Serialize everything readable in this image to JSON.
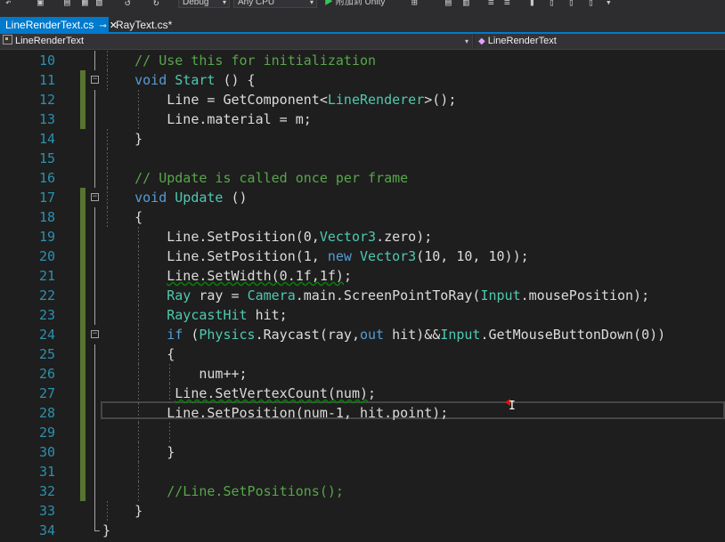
{
  "toolbar": {
    "config_value": "Debug",
    "platform_value": "Any CPU",
    "run_label": "附加到 Unity",
    "play_icon": "play-icon"
  },
  "tabs": [
    {
      "label": "LineRenderText.cs",
      "active": true
    },
    {
      "label": "RayText.cs*",
      "active": false
    }
  ],
  "navbar": {
    "class_selector": "LineRenderText",
    "member_selector": "LineRenderText"
  },
  "colors": {
    "accent": "#007acc",
    "keyword": "#569cd6",
    "type": "#4ec9b0",
    "comment": "#57a64a",
    "line_number": "#2b91af",
    "change_bar": "#577430"
  },
  "editor": {
    "current_line": 28,
    "lines": [
      {
        "n": "10",
        "segments": [
          [
            "cm",
            "    // Use this for initialization"
          ]
        ]
      },
      {
        "n": "11",
        "segments": [
          [
            "kw",
            "    void"
          ],
          [
            "pl",
            " "
          ],
          [
            "ty",
            "Start"
          ],
          [
            "pl",
            " () {"
          ]
        ]
      },
      {
        "n": "12",
        "segments": [
          [
            "pl",
            "        Line = GetComponent"
          ],
          [
            "pl",
            "<"
          ],
          [
            "ty",
            "LineRenderer"
          ],
          [
            "pl",
            ">();"
          ]
        ]
      },
      {
        "n": "13",
        "segments": [
          [
            "pl",
            "        Line.material = m;"
          ]
        ]
      },
      {
        "n": "14",
        "segments": [
          [
            "pl",
            "    }"
          ]
        ]
      },
      {
        "n": "15",
        "segments": [
          [
            "pl",
            ""
          ]
        ]
      },
      {
        "n": "16",
        "segments": [
          [
            "cm",
            "    // Update is called once per frame"
          ]
        ]
      },
      {
        "n": "17",
        "segments": [
          [
            "kw",
            "    void"
          ],
          [
            "pl",
            " "
          ],
          [
            "ty",
            "Update"
          ],
          [
            "pl",
            " ()"
          ]
        ]
      },
      {
        "n": "18",
        "segments": [
          [
            "pl",
            "    {"
          ]
        ]
      },
      {
        "n": "19",
        "segments": [
          [
            "pl",
            "        Line.SetPosition(0,"
          ],
          [
            "ty",
            "Vector3"
          ],
          [
            "pl",
            ".zero);"
          ]
        ]
      },
      {
        "n": "20",
        "segments": [
          [
            "pl",
            "        Line.SetPosition(1, "
          ],
          [
            "kw",
            "new"
          ],
          [
            "pl",
            " "
          ],
          [
            "ty",
            "Vector3"
          ],
          [
            "pl",
            "(10, 10, 10));"
          ]
        ]
      },
      {
        "n": "21",
        "segments": [
          [
            "pl",
            "        "
          ],
          [
            "sq",
            "Line.SetWidth(0.1f,1f)"
          ],
          [
            "pl",
            ";"
          ]
        ]
      },
      {
        "n": "22",
        "segments": [
          [
            "ty",
            "        Ray"
          ],
          [
            "pl",
            " ray = "
          ],
          [
            "ty",
            "Camera"
          ],
          [
            "pl",
            ".main.ScreenPointToRay("
          ],
          [
            "ty",
            "Input"
          ],
          [
            "pl",
            ".mousePosition);"
          ]
        ]
      },
      {
        "n": "23",
        "segments": [
          [
            "ty",
            "        RaycastHit"
          ],
          [
            "pl",
            " hit;"
          ]
        ]
      },
      {
        "n": "24",
        "segments": [
          [
            "kw",
            "        if"
          ],
          [
            "pl",
            " ("
          ],
          [
            "ty",
            "Physics"
          ],
          [
            "pl",
            ".Raycast(ray,"
          ],
          [
            "kw",
            "out"
          ],
          [
            "pl",
            " hit)&&"
          ],
          [
            "ty",
            "Input"
          ],
          [
            "pl",
            ".GetMouseButtonDown(0))"
          ]
        ]
      },
      {
        "n": "25",
        "segments": [
          [
            "pl",
            "        {"
          ]
        ]
      },
      {
        "n": "26",
        "segments": [
          [
            "pl",
            "            num++;"
          ]
        ]
      },
      {
        "n": "27",
        "segments": [
          [
            "pl",
            "         "
          ],
          [
            "sq",
            "Line.SetVertexCount(num)"
          ],
          [
            "pl",
            ";"
          ]
        ]
      },
      {
        "n": "28",
        "segments": [
          [
            "pl",
            "        Line.SetPosition(num-1, hit.point);"
          ]
        ]
      },
      {
        "n": "29",
        "segments": [
          [
            "pl",
            ""
          ]
        ]
      },
      {
        "n": "30",
        "segments": [
          [
            "pl",
            "        }"
          ]
        ]
      },
      {
        "n": "31",
        "segments": [
          [
            "pl",
            ""
          ]
        ]
      },
      {
        "n": "32",
        "segments": [
          [
            "cm",
            "        //Line.SetPositions();"
          ]
        ]
      },
      {
        "n": "33",
        "segments": [
          [
            "pl",
            "    }"
          ]
        ]
      },
      {
        "n": "34",
        "segments": [
          [
            "pl",
            "}"
          ]
        ]
      }
    ]
  }
}
